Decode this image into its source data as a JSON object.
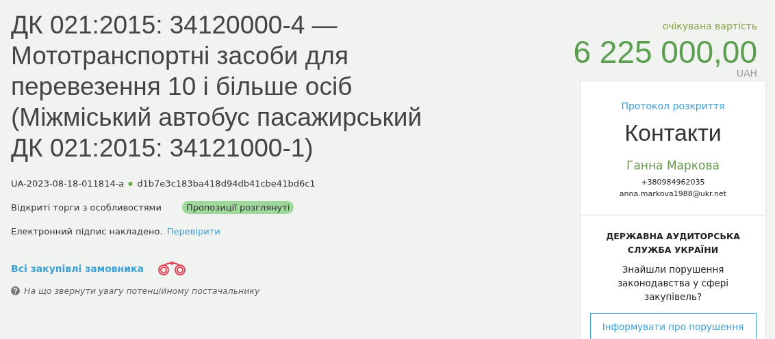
{
  "title": "ДК 021:2015: 34120000-4 — Мототранспортні засоби для перевезення 10 і більше осіб (Міжміський автобус пасажирський ДК 021:2015: 34121000-1)",
  "tender_id": "UA-2023-08-18-011814-a",
  "separator": "●",
  "hash": "d1b7e3c183ba418d94db41cbe41bd6c1",
  "procedure": "Відкриті торги з особливостями",
  "status_badge": {
    "label": "Пропозиції розглянуті",
    "color": "#9ed89a"
  },
  "signature": {
    "text": "Електронний підпис накладено.",
    "link": "Перевірити"
  },
  "all_purchases_link": "Всі закупівлі замовника",
  "hint": "На що звернути увагу потенційному постачальнику",
  "budget": {
    "label": "очікувана вартість",
    "amount": "6 225 000,00",
    "currency": "UAH"
  },
  "contacts": {
    "protocol_link": "Протокол розкриття",
    "heading": "Контакти",
    "name": "Ганна Маркова",
    "phone": "+380984962035",
    "email": "anna.markova1988@ukr.net"
  },
  "audit": {
    "title": "ДЕРЖАВНА АУДИТОРСЬКА СЛУЖБА УКРАЇНИ",
    "question": "Знайшли порушення законодавства у сфері закупівель?",
    "button": "Інформувати про порушення"
  }
}
